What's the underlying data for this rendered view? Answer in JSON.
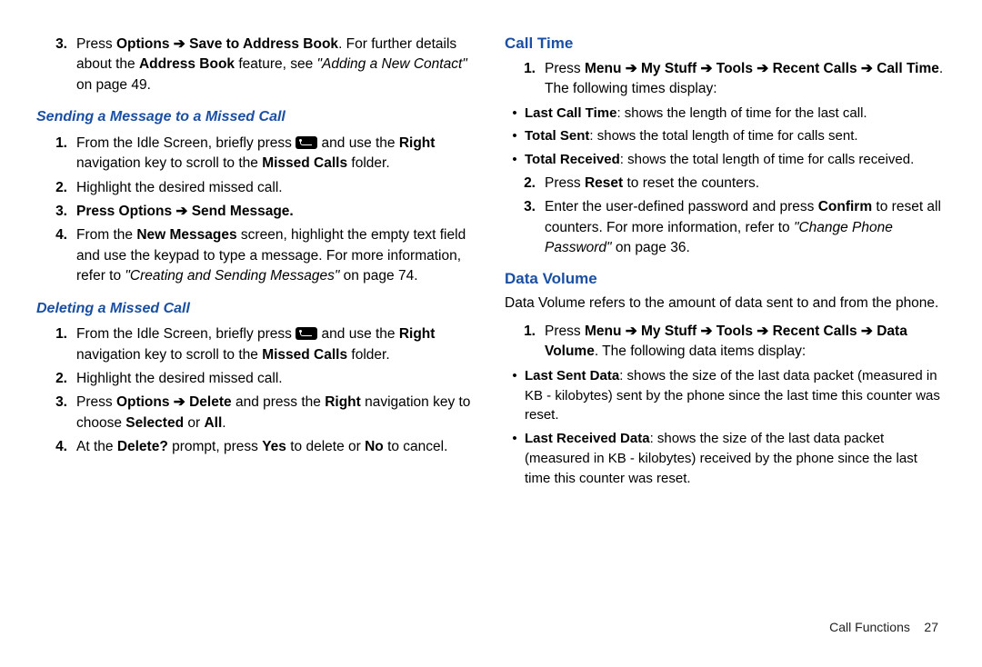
{
  "left": {
    "step3_a": "Press ",
    "step3_b": "Options",
    "step3_c": " ➔ ",
    "step3_d": "Save to Address Book",
    "step3_e": ". For further details about the ",
    "step3_f": "Address Book",
    "step3_g": " feature, see ",
    "step3_h": "\"Adding a New Contact\"",
    "step3_i": " on page 49.",
    "h_send": "Sending a Message to a Missed Call",
    "send1_a": "From the Idle Screen, briefly press ",
    "send1_b": " and use the ",
    "send1_c": "Right",
    "send1_d": " navigation key to scroll to the ",
    "send1_e": "Missed Calls",
    "send1_f": " folder.",
    "send2": "Highlight the desired missed call.",
    "send3_a": "Press ",
    "send3_b": "Options",
    "send3_c": " ➔ ",
    "send3_d": "Send Message",
    "send3_e": ".",
    "send4_a": "From the ",
    "send4_b": "New Messages",
    "send4_c": " screen, highlight the empty text field and use the keypad to type a message. For more information, refer to ",
    "send4_d": "\"Creating and Sending Messages\"",
    "send4_e": "  on page 74.",
    "h_del": "Deleting a Missed Call",
    "del1_a": "From the Idle Screen, briefly press ",
    "del1_b": " and use the ",
    "del1_c": "Right",
    "del1_d": " navigation key to scroll to the ",
    "del1_e": "Missed Calls",
    "del1_f": " folder.",
    "del2": "Highlight the desired missed call.",
    "del3_a": "Press ",
    "del3_b": "Options",
    "del3_c": " ➔ ",
    "del3_d": "Delete",
    "del3_e": " and press the ",
    "del3_f": "Right",
    "del3_g": " navigation key to choose ",
    "del3_h": "Selected",
    "del3_i": " or ",
    "del3_j": "All",
    "del3_k": ".",
    "del4_a": "At the ",
    "del4_b": "Delete?",
    "del4_c": " prompt, press ",
    "del4_d": "Yes",
    "del4_e": " to delete or ",
    "del4_f": "No",
    "del4_g": " to cancel."
  },
  "right": {
    "h_calltime": "Call Time",
    "ct1_a": "Press ",
    "ct1_b": "Menu",
    "ct1_c": " ➔ ",
    "ct1_d": "My Stuff",
    "ct1_e": " ➔ ",
    "ct1_f": " Tools ",
    "ct1_g": " ➔ ",
    "ct1_h": "Recent Calls",
    "ct1_i": " ➔ ",
    "ct1_j": "Call Time",
    "ct1_k": ". The following times display:",
    "ct_b1_a": "Last Call Time",
    "ct_b1_b": ": shows the length of time for the last call.",
    "ct_b2_a": "Total Sent",
    "ct_b2_b": ": shows the total length of time for calls sent.",
    "ct_b3_a": "Total Received",
    "ct_b3_b": ": shows the total length of time for calls received.",
    "ct2_a": "Press ",
    "ct2_b": "Reset",
    "ct2_c": " to reset the counters.",
    "ct3_a": "Enter the user-defined password and press ",
    "ct3_b": "Confirm",
    "ct3_c": " to reset all counters. For more information, refer to ",
    "ct3_d": "\"Change Phone Password\"",
    "ct3_e": "  on page 36.",
    "h_datavol": "Data Volume",
    "dv_intro": "Data Volume refers to the amount of data sent to and from the phone.",
    "dv1_a": "Press ",
    "dv1_b": "Menu",
    "dv1_c": " ➔ ",
    "dv1_d": "My Stuff",
    "dv1_e": " ➔ ",
    "dv1_f": "Tools",
    "dv1_g": " ➔ ",
    "dv1_h": "Recent Calls",
    "dv1_i": " ➔ ",
    "dv1_j": "Data Volume",
    "dv1_k": ". The following data items display:",
    "dv_b1_a": "Last Sent Data",
    "dv_b1_b": ": shows the size of the last data packet (measured in KB - kilobytes) sent by the phone since the last time this counter was reset.",
    "dv_b2_a": "Last Received Data",
    "dv_b2_b": ": shows the size of the last data packet (measured in KB - kilobytes) received by the phone since the last time this counter was reset."
  },
  "footer_label": "Call Functions",
  "footer_page": "27"
}
